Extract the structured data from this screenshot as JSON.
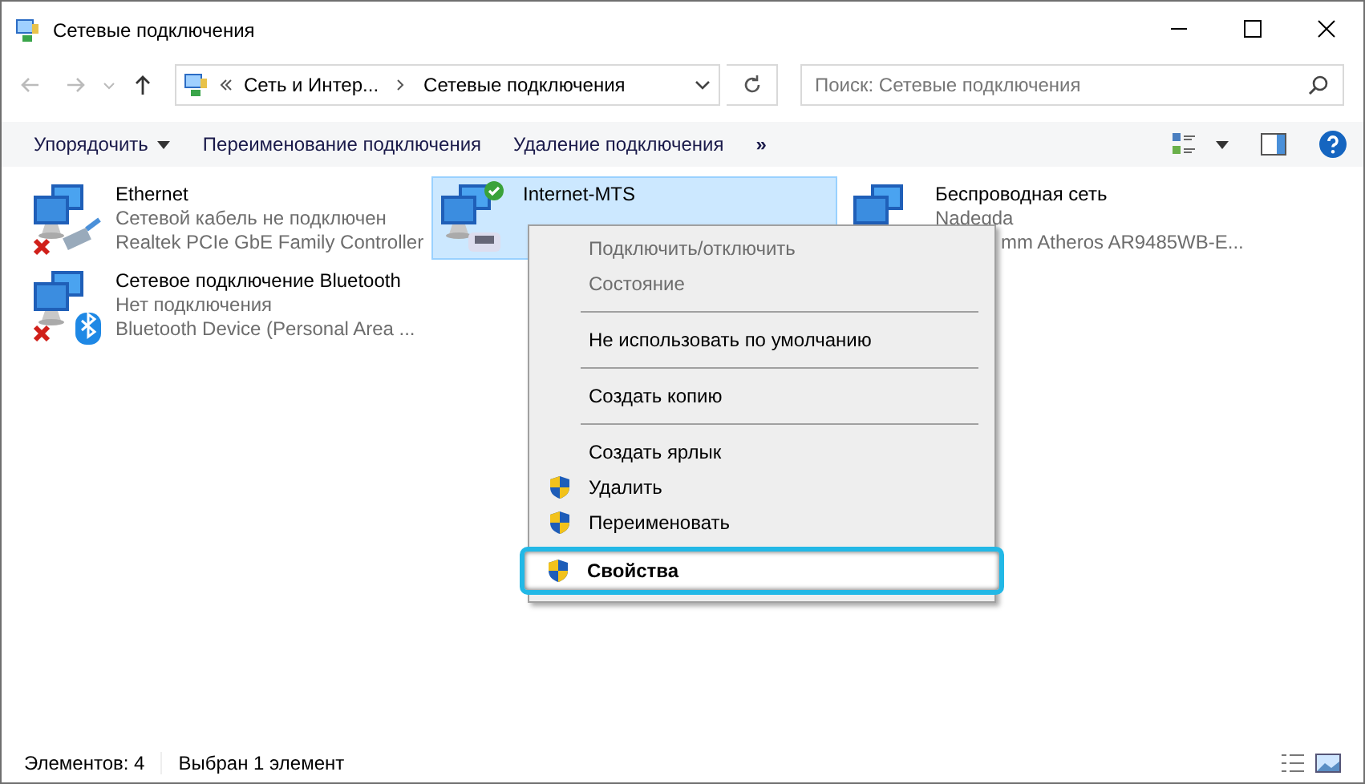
{
  "window": {
    "title": "Сетевые подключения"
  },
  "address": {
    "crumbs": [
      "Сеть и Интер...",
      "Сетевые подключения"
    ]
  },
  "search": {
    "placeholder": "Поиск: Сетевые подключения"
  },
  "toolbar": {
    "items": [
      "Упорядочить",
      "Переименование подключения",
      "Удаление подключения"
    ],
    "more": "»"
  },
  "connections": [
    {
      "name": "Ethernet",
      "lines": [
        "Сетевой кабель не подключен",
        "Realtek PCIe GbE Family Controller"
      ],
      "selected": false,
      "kind": "cable",
      "connected": false
    },
    {
      "name": "Internet-MTS",
      "selected": true,
      "kind": "phone",
      "connected": true
    },
    {
      "name": "Беспроводная сеть",
      "lines": [
        "Nadegda",
        "mm Atheros AR9485WB-E..."
      ],
      "selected": false,
      "kind": "plain",
      "connected": false
    },
    {
      "name": "Сетевое подключение Bluetooth",
      "lines": [
        "Нет подключения",
        "Bluetooth Device (Personal Area ..."
      ],
      "selected": false,
      "kind": "bluetooth",
      "connected": false
    }
  ],
  "context_menu": [
    {
      "kind": "item",
      "label": "Подключить/отключить",
      "disabled": true,
      "shield": false,
      "selected": false
    },
    {
      "kind": "item",
      "label": "Состояние",
      "disabled": true,
      "shield": false,
      "selected": false
    },
    {
      "kind": "separator"
    },
    {
      "kind": "item",
      "label": "Не использовать по умолчанию",
      "disabled": false,
      "shield": false,
      "selected": false
    },
    {
      "kind": "separator"
    },
    {
      "kind": "item",
      "label": "Создать копию",
      "disabled": false,
      "shield": false,
      "selected": false
    },
    {
      "kind": "separator"
    },
    {
      "kind": "item",
      "label": "Создать ярлык",
      "disabled": false,
      "shield": false,
      "selected": false
    },
    {
      "kind": "item",
      "label": "Удалить",
      "disabled": false,
      "shield": true,
      "selected": false
    },
    {
      "kind": "item",
      "label": "Переименовать",
      "disabled": false,
      "shield": true,
      "selected": false
    },
    {
      "kind": "item",
      "label": "Свойства",
      "disabled": false,
      "shield": true,
      "selected": true
    }
  ],
  "status_bar": {
    "count": "Элементов: 4",
    "selection": "Выбран 1 элемент"
  }
}
